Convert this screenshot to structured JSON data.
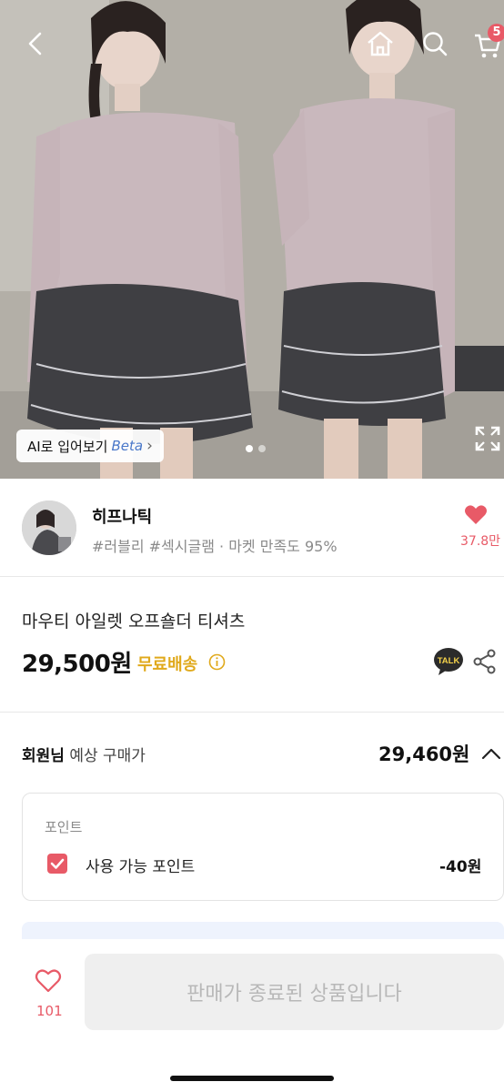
{
  "header": {
    "back_icon": "chevron-left-icon",
    "home_icon": "home-icon",
    "search_icon": "search-icon",
    "cart_icon": "cart-icon",
    "cart_badge": "5"
  },
  "gallery": {
    "ai_tryon_label": "AI로 입어보기",
    "ai_tryon_beta": "Beta",
    "ai_tryon_chevron": "›",
    "page_count": 2,
    "active_page": 1,
    "expand_icon": "expand-icon"
  },
  "seller": {
    "name": "히프나틱",
    "meta": "#러블리 #섹시글램 · 마켓 만족도 95%",
    "like_count": "37.8만"
  },
  "product": {
    "title": "마우티 아일렛 오프숄더 티셔츠",
    "price": "29,500원",
    "shipping": "무료배송"
  },
  "member_price": {
    "label_bold": "회원님",
    "label_rest": " 예상 구매가",
    "value": "29,460원"
  },
  "points": {
    "heading": "포인트",
    "item_label": "사용 가능 포인트",
    "item_value": "-40원",
    "checked": true
  },
  "bottom": {
    "wish_count": "101",
    "status_button": "판매가 종료된 상품입니다"
  },
  "colors": {
    "accent": "#e85a67",
    "shipping": "#e0a91b",
    "beta": "#4a78c9"
  }
}
